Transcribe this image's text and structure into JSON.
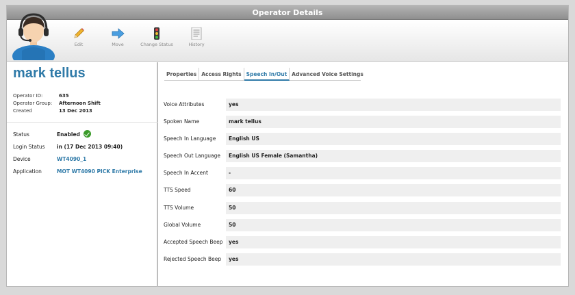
{
  "window": {
    "title": "Operator Details"
  },
  "toolbar": {
    "buttons": [
      {
        "label": "Edit",
        "icon": "pencil-icon"
      },
      {
        "label": "Move",
        "icon": "arrow-right-icon"
      },
      {
        "label": "Change Status",
        "icon": "traffic-light-icon"
      },
      {
        "label": "History",
        "icon": "document-icon"
      }
    ]
  },
  "operator": {
    "name": "mark tellus",
    "info": [
      {
        "key": "Operator ID:",
        "value": "635"
      },
      {
        "key": "Operator Group:",
        "value": "Afternoon Shift"
      },
      {
        "key": "Created",
        "value": "13 Dec 2013"
      }
    ],
    "status": [
      {
        "key": "Status",
        "value": "Enabled"
      },
      {
        "key": "Login Status",
        "value": "in (17 Dec 2013 09:40)"
      },
      {
        "key": "Device",
        "value": "WT4090_1"
      },
      {
        "key": "Application",
        "value": "MOT WT4090 PICK Enterprise"
      }
    ]
  },
  "tabs": [
    {
      "label": "Properties"
    },
    {
      "label": "Access Rights"
    },
    {
      "label": "Speech In/Out",
      "active": true
    },
    {
      "label": "Advanced Voice Settings"
    }
  ],
  "speech": [
    {
      "label": "Voice Attributes",
      "value": "yes"
    },
    {
      "label": "Spoken Name",
      "value": "mark tellus"
    },
    {
      "label": "Speech In Language",
      "value": "English US"
    },
    {
      "label": "Speech Out Language",
      "value": "English US Female (Samantha)"
    },
    {
      "label": "Speech In Accent",
      "value": "-"
    },
    {
      "label": "TTS Speed",
      "value": "60"
    },
    {
      "label": "TTS Volume",
      "value": "50"
    },
    {
      "label": "Global Volume",
      "value": "50"
    },
    {
      "label": "Accepted Speech Beep",
      "value": "yes"
    },
    {
      "label": "Rejected Speech Beep",
      "value": "yes"
    }
  ],
  "colors": {
    "accent": "#2f7aa8",
    "status_ok": "#3b9b2a",
    "titlebar": "#9e9e9e"
  }
}
